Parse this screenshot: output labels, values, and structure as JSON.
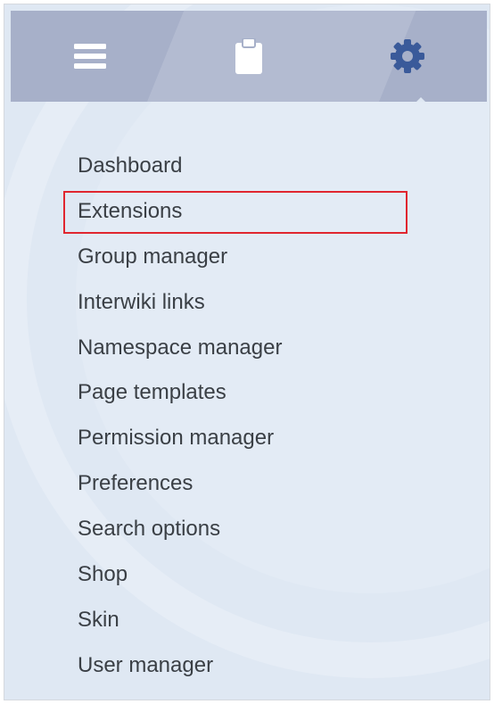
{
  "tabs": [
    {
      "name": "navigation",
      "icon": "hamburger-menu-icon",
      "active": false
    },
    {
      "name": "pages",
      "icon": "clipboard-icon",
      "active": false
    },
    {
      "name": "administration",
      "icon": "gear-icon",
      "active": true
    }
  ],
  "menu": {
    "items": [
      {
        "label": "Dashboard"
      },
      {
        "label": "Extensions",
        "highlighted": true
      },
      {
        "label": "Group manager"
      },
      {
        "label": "Interwiki links"
      },
      {
        "label": "Namespace manager"
      },
      {
        "label": "Page templates"
      },
      {
        "label": "Permission manager"
      },
      {
        "label": "Preferences"
      },
      {
        "label": "Search options"
      },
      {
        "label": "Shop"
      },
      {
        "label": "Skin"
      },
      {
        "label": "User manager"
      }
    ]
  },
  "colors": {
    "tab_bar": "#a7b0c9",
    "panel_background": "#dfe8f3",
    "active_icon": "#3a5a9a",
    "inactive_icon": "#ffffff",
    "highlight_border": "#e0262f",
    "menu_text": "#3a3f45"
  }
}
